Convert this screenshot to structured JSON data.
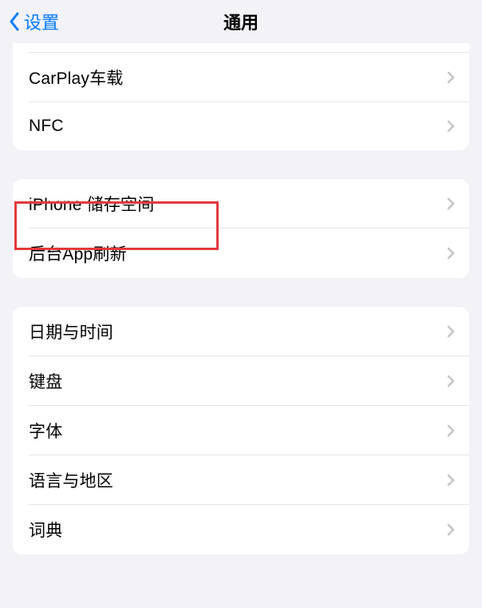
{
  "nav": {
    "back_label": "设置",
    "title": "通用"
  },
  "groups": [
    {
      "items": [
        {
          "label": "CarPlay车载"
        },
        {
          "label": "NFC"
        }
      ]
    },
    {
      "items": [
        {
          "label": "iPhone 储存空间"
        },
        {
          "label": "后台App刷新"
        }
      ]
    },
    {
      "items": [
        {
          "label": "日期与时间"
        },
        {
          "label": "键盘"
        },
        {
          "label": "字体"
        },
        {
          "label": "语言与地区"
        },
        {
          "label": "词典"
        }
      ]
    }
  ]
}
